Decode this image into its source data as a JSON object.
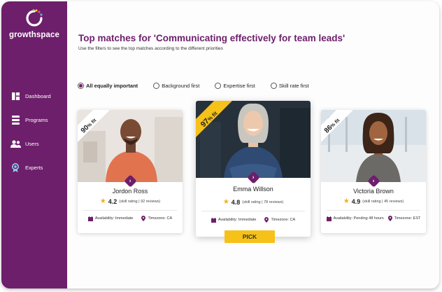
{
  "app": {
    "brand": "growthspace"
  },
  "sidebar": {
    "items": [
      {
        "label": "Dashboard",
        "icon": "dashboard-icon"
      },
      {
        "label": "Programs",
        "icon": "programs-icon"
      },
      {
        "label": "Users",
        "icon": "users-icon"
      },
      {
        "label": "Experts",
        "icon": "experts-icon"
      }
    ]
  },
  "header": {
    "title": "Top matches for 'Communicating effectively for team leads'",
    "subtitle": "Use the filters to see the top matches according to the different priorities"
  },
  "filters": [
    {
      "label": "All equally important",
      "checked": true
    },
    {
      "label": "Background first",
      "checked": false
    },
    {
      "label": "Expertise first",
      "checked": false
    },
    {
      "label": "Skill rate first",
      "checked": false
    }
  ],
  "cards": [
    {
      "fit_value": "90",
      "fit_unit": "% fit",
      "name": "Jordon Ross",
      "rating": "4.2",
      "rating_detail": "(skill rating | 92 reviews)",
      "availability": "Availability: Immediate",
      "timezone": "Timezone: CA"
    },
    {
      "fit_value": "97",
      "fit_unit": "% fit",
      "name": "Emma Willson",
      "rating": "4.8",
      "rating_detail": "(skill rating | 78 reviews)",
      "availability": "Availability: Immediate",
      "timezone": "Timezone: CA"
    },
    {
      "fit_value": "86",
      "fit_unit": "% fit",
      "name": "Victoria Brown",
      "rating": "4.9",
      "rating_detail": "(skill rating | 45 reviews)",
      "availability": "Availability: Pending 48 hours",
      "timezone": "Timezone: EST"
    }
  ],
  "pick_label": "PICK",
  "colors": {
    "brand_purple": "#6d1f6b",
    "pick_yellow": "#f6c118",
    "ribbon_white": "#ffffff",
    "ribbon_yellow": "#f6c118",
    "star": "#f2b01e"
  }
}
